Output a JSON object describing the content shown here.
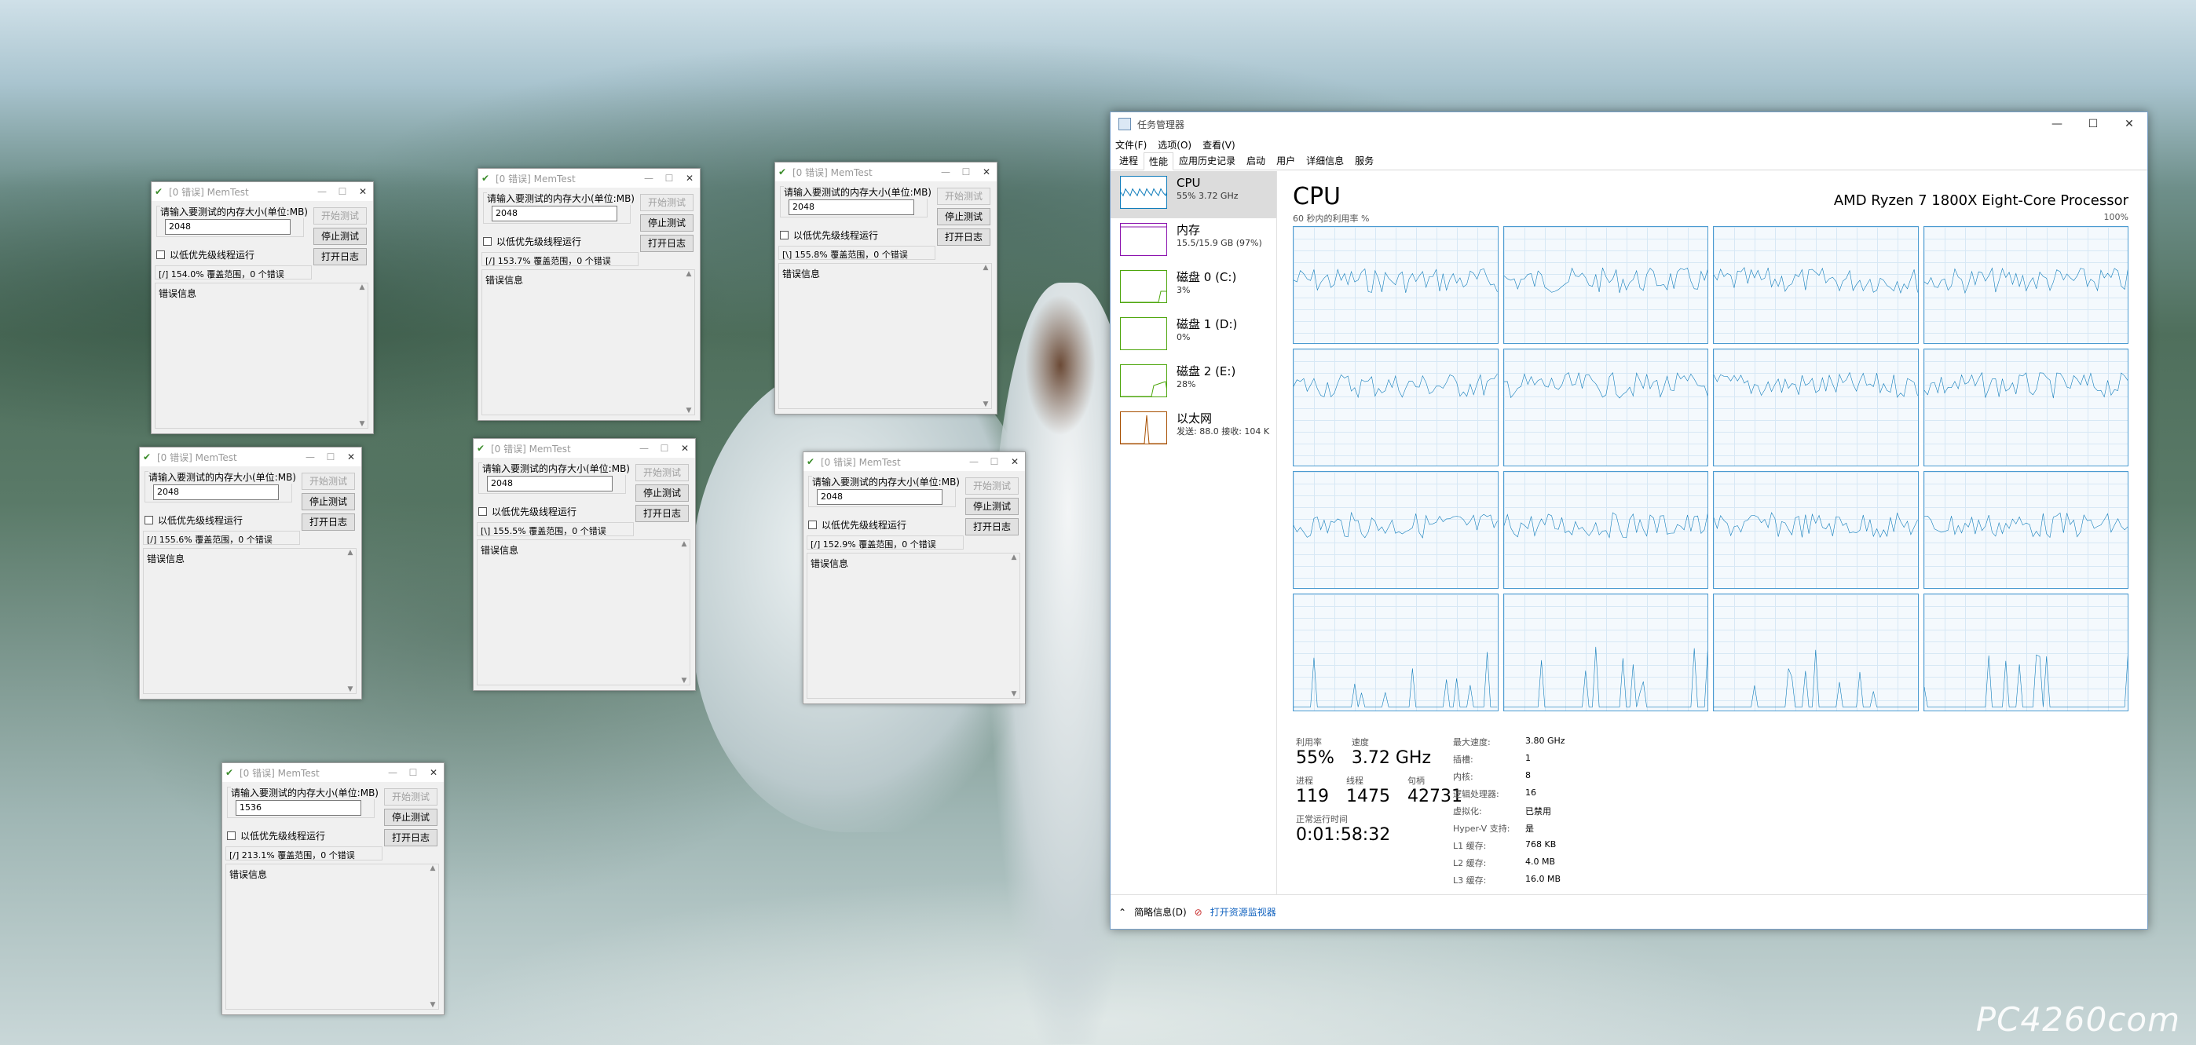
{
  "watermark": "PC4260com",
  "memtest": {
    "title": "[0 错误] MemTest",
    "prompt": "请输入要测试的内存大小(单位:MB)",
    "start_label": "开始测试",
    "stop_label": "停止测试",
    "log_label": "打开日志",
    "lowprio_label": "以低优先级线程运行",
    "error_label": "错误信息",
    "windows": [
      {
        "value": "2048",
        "status": "[/]  154.0% 覆盖范围，0 个错误"
      },
      {
        "value": "2048",
        "status": "[/]  153.7% 覆盖范围，0 个错误"
      },
      {
        "value": "2048",
        "status": "[\\]  155.8% 覆盖范围，0 个错误"
      },
      {
        "value": "2048",
        "status": "[/]  155.6% 覆盖范围，0 个错误"
      },
      {
        "value": "2048",
        "status": "[\\]  155.5% 覆盖范围，0 个错误"
      },
      {
        "value": "2048",
        "status": "[/]  152.9% 覆盖范围，0 个错误"
      },
      {
        "value": "1536",
        "status": "[/]  213.1% 覆盖范围，0 个错误"
      }
    ]
  },
  "taskmanager": {
    "title": "任务管理器",
    "menu": [
      "文件(F)",
      "选项(O)",
      "查看(V)"
    ],
    "tabs": [
      "进程",
      "性能",
      "应用历史记录",
      "启动",
      "用户",
      "详细信息",
      "服务"
    ],
    "sidebar": [
      {
        "name": "CPU",
        "value": "55% 3.72 GHz",
        "color": "#117dbb"
      },
      {
        "name": "内存",
        "value": "15.5/15.9 GB (97%)",
        "color": "#8b12ae"
      },
      {
        "name": "磁盘 0 (C:)",
        "value": "3%",
        "color": "#4da60c"
      },
      {
        "name": "磁盘 1 (D:)",
        "value": "0%",
        "color": "#4da60c"
      },
      {
        "name": "磁盘 2 (E:)",
        "value": "28%",
        "color": "#4da60c"
      },
      {
        "name": "以太网",
        "value": "发送: 88.0  接收: 104 K",
        "color": "#a74f01"
      }
    ],
    "heading": "CPU",
    "processor": "AMD Ryzen 7 1800X Eight-Core Processor",
    "caption_left": "60 秒内的利用率 %",
    "caption_right": "100%",
    "stats": {
      "util_label": "利用率",
      "util": "55%",
      "speed_label": "速度",
      "speed": "3.72 GHz",
      "proc_label": "进程",
      "proc": "119",
      "threads_label": "线程",
      "threads": "1475",
      "handles_label": "句柄",
      "handles": "42731",
      "uptime_label": "正常运行时间",
      "uptime": "0:01:58:32"
    },
    "specs": [
      [
        "最大速度:",
        "3.80 GHz"
      ],
      [
        "插槽:",
        "1"
      ],
      [
        "内核:",
        "8"
      ],
      [
        "逻辑处理器:",
        "16"
      ],
      [
        "虚拟化:",
        "已禁用"
      ],
      [
        "Hyper-V 支持:",
        "是"
      ],
      [
        "L1 缓存:",
        "768 KB"
      ],
      [
        "L2 缓存:",
        "4.0 MB"
      ],
      [
        "L3 缓存:",
        "16.0 MB"
      ]
    ],
    "footer_less": "简略信息(D)",
    "footer_link": "打开资源监视器"
  }
}
